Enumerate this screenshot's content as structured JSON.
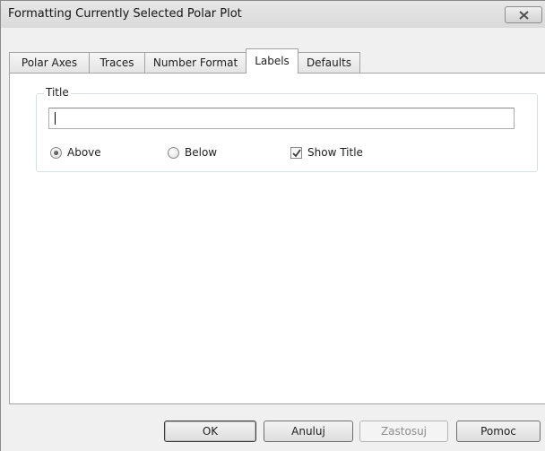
{
  "window": {
    "title": "Formatting Currently Selected Polar Plot"
  },
  "tabs": [
    {
      "label": "Polar Axes"
    },
    {
      "label": "Traces"
    },
    {
      "label": "Number Format"
    },
    {
      "label": "Labels",
      "active": true
    },
    {
      "label": "Defaults"
    }
  ],
  "title_group": {
    "legend": "Title",
    "input_value": "",
    "position_options": [
      {
        "label": "Above",
        "selected": true
      },
      {
        "label": "Below",
        "selected": false
      }
    ],
    "show_title": {
      "label": "Show Title",
      "checked": true
    }
  },
  "buttons": {
    "ok": "OK",
    "cancel": "Anuluj",
    "apply": "Zastosuj",
    "help": "Pomoc"
  },
  "icons": {
    "close": "close-icon",
    "check": "check-icon"
  },
  "colors": {
    "panel": "#ffffff",
    "window": "#f0f0f0",
    "border": "#a3a3a3"
  }
}
